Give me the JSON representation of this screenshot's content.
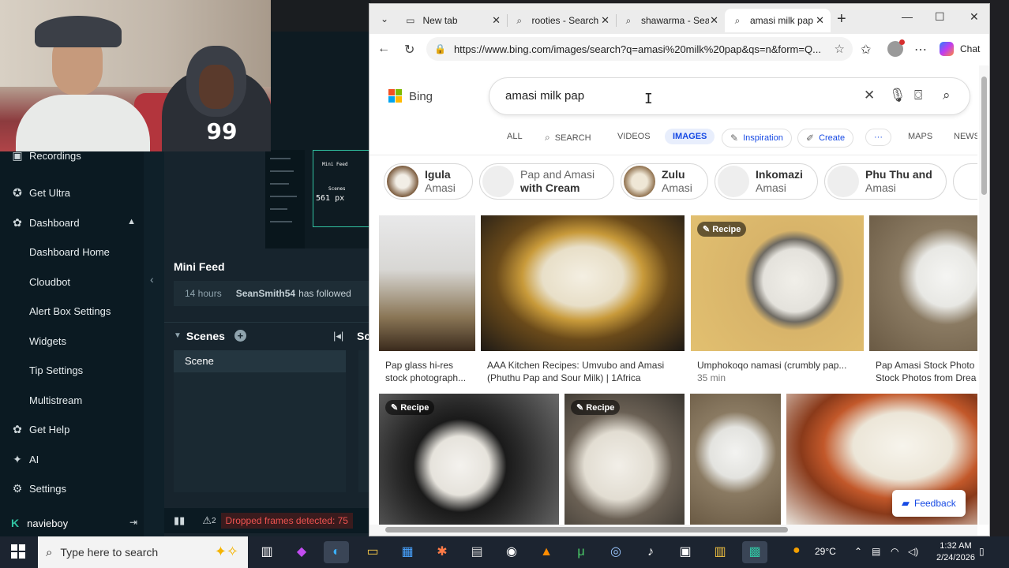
{
  "streamlabs": {
    "sidebar": {
      "items": [
        {
          "label": "Recordings",
          "icon": "recordings-icon"
        },
        {
          "label": "Get Ultra",
          "icon": "ultra-icon"
        },
        {
          "label": "Dashboard",
          "icon": "dashboard-icon"
        },
        {
          "label": "Dashboard Home"
        },
        {
          "label": "Cloudbot"
        },
        {
          "label": "Alert Box Settings"
        },
        {
          "label": "Widgets"
        },
        {
          "label": "Tip Settings"
        },
        {
          "label": "Multistream"
        },
        {
          "label": "Get Help",
          "icon": "help-icon"
        },
        {
          "label": "AI",
          "icon": "ai-icon"
        },
        {
          "label": "Settings",
          "icon": "gear-icon"
        }
      ],
      "username": "navieboy"
    },
    "preview_measure": "561 px",
    "preview_mini": {
      "mini_feed": "Mini Feed",
      "scenes": "Scenes"
    },
    "mini_feed": {
      "title": "Mini Feed",
      "time": "14 hours",
      "user": "SeanSmith54",
      "action": "has followed"
    },
    "scenes": {
      "title": "Scenes",
      "sources_partial": "Sc",
      "items": [
        "Scene"
      ]
    },
    "status": {
      "warn_count": "2",
      "dropped": "Dropped frames detected: 75"
    },
    "accent_color": "#31c3a2",
    "webcam_shirt_print": "99"
  },
  "browser": {
    "tabs": [
      {
        "title": "New tab",
        "icon": "newtab-icon"
      },
      {
        "title": "rooties - Search",
        "icon": "search-icon"
      },
      {
        "title": "shawarma - Search",
        "icon": "search-icon"
      },
      {
        "title": "amasi milk pap - Search",
        "icon": "search-icon",
        "active": true
      }
    ],
    "url": "https://www.bing.com/images/search?q=amasi%20milk%20pap&qs=n&form=Q...",
    "chat_label": "Chat",
    "bing": {
      "logo": "Bing",
      "query": "amasi milk pap",
      "nav": [
        "ALL",
        "SEARCH",
        "VIDEOS",
        "IMAGES",
        "Inspiration",
        "Create",
        "···",
        "MAPS",
        "NEWS"
      ],
      "chips": [
        {
          "l1": "Igula",
          "l2": "Amasi"
        },
        {
          "l1": "Pap and Amasi",
          "l2": "with Cream"
        },
        {
          "l1": "Zulu",
          "l2": "Amasi"
        },
        {
          "l1": "Inkomazi",
          "l2": "Amasi"
        },
        {
          "l1": "Phu Thu and",
          "l2": "Amasi"
        }
      ],
      "row1": [
        {
          "caption1": "Pap glass hi-res",
          "caption2": "stock photograph..."
        },
        {
          "caption1": "AAA Kitchen Recipes: Umvubo and Amasi",
          "caption2": "(Phuthu Pap and Sour Milk) | 1Africa"
        },
        {
          "badge": "Recipe",
          "caption1": "Umphokoqo namasi (crumbly pap...",
          "caption2": "35 min"
        },
        {
          "caption1": "Pap Amasi Stock Photo",
          "caption2": "Stock Photos from Drea"
        }
      ],
      "row2_badges": [
        "Recipe",
        "Recipe"
      ],
      "feedback": "Feedback"
    }
  },
  "taskbar": {
    "search_placeholder": "Type here to search",
    "weather": "29°C",
    "time": "1:32 AM",
    "date": "2/24/2026"
  }
}
